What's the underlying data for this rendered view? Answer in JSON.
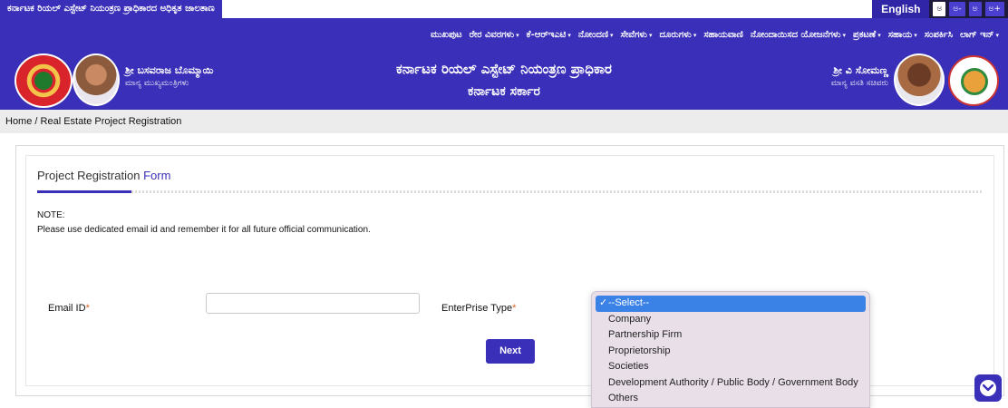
{
  "topbar": {
    "official_portal": "ಕರ್ನಾಟಕ ರಿಯಲ್ ಎಸ್ಟೇಟ್ ನಿಯಂತ್ರಣ ಪ್ರಾಧಿಕಾರದ ಅಧಿಕೃತ ಜಾಲತಾಣ",
    "language": "English",
    "font_sizes": [
      "ಅ",
      "ಅ-",
      "ಅ",
      "ಅ+"
    ]
  },
  "nav": {
    "items": [
      {
        "label": "ಮುಖಪುಟ",
        "has_menu": false
      },
      {
        "label": "ರೇರ ವಿವರಗಳು",
        "has_menu": true
      },
      {
        "label": "ಕೆ-ಆರ್‌ಇಎಟಿ",
        "has_menu": true
      },
      {
        "label": "ನೋಂದಣಿ",
        "has_menu": true
      },
      {
        "label": "ಸೇವೆಗಳು",
        "has_menu": true
      },
      {
        "label": "ದೂರುಗಳು",
        "has_menu": true
      },
      {
        "label": "ಸಹಾಯವಾಣಿ",
        "has_menu": false
      },
      {
        "label": "ನೋಂದಾಯಿಸದ ಯೋಜನೆಗಳು",
        "has_menu": true
      },
      {
        "label": "ಪ್ರಕಟಣೆ",
        "has_menu": true
      },
      {
        "label": "ಸಹಾಯ",
        "has_menu": true
      },
      {
        "label": "ಸಂಪರ್ಕಿಸಿ",
        "has_menu": false
      },
      {
        "label": "ಲಾಗ್ ಇನ್",
        "has_menu": true
      }
    ]
  },
  "banner": {
    "cm_name": "ಶ್ರೀ ಬಸವರಾಜ ಬೊಮ್ಮಾಯಿ",
    "cm_designation": "ಮಾನ್ಯ ಮುಖ್ಯಮಂತ್ರಿಗಳು",
    "title": "ಕರ್ನಾಟಕ ರಿಯಲ್ ಎಸ್ಟೇಟ್ ನಿಯಂತ್ರಣ ಪ್ರಾಧಿಕಾರ",
    "subtitle": "ಕರ್ನಾಟಕ ಸರ್ಕಾರ",
    "minister_name": "ಶ್ರೀ ವಿ ಸೋಮಣ್ಣ",
    "minister_designation": "ಮಾನ್ಯ ವಸತಿ ಸಚಿವರು",
    "emblem_text": "GOVERNMENT OF KARNATAKA"
  },
  "breadcrumb": "Home / Real Estate Project Registration",
  "form": {
    "title_main": "Project Registration",
    "title_accent": "Form",
    "note_heading": "NOTE:",
    "note_text": "Please use dedicated email id and remember it for all future official communication.",
    "email_label": "Email ID",
    "email_value": "",
    "enterprise_label": "EnterPrise Type",
    "required_mark": "*",
    "next_label": "Next"
  },
  "enterprise_options": [
    {
      "label": "--Select--",
      "selected": true
    },
    {
      "label": "Company",
      "selected": false
    },
    {
      "label": "Partnership Firm",
      "selected": false
    },
    {
      "label": "Proprietorship",
      "selected": false
    },
    {
      "label": "Societies",
      "selected": false
    },
    {
      "label": "Development Authority / Public Body / Government Body",
      "selected": false
    },
    {
      "label": "Others",
      "selected": false
    }
  ],
  "colors": {
    "brand": "#3a2fb8",
    "required": "#e0641a",
    "selected_option": "#3b82e6",
    "dropdown_bg": "#e9dfe8"
  },
  "icons": {
    "scroll": "chevron-down-icon",
    "check": "checkmark-icon"
  }
}
